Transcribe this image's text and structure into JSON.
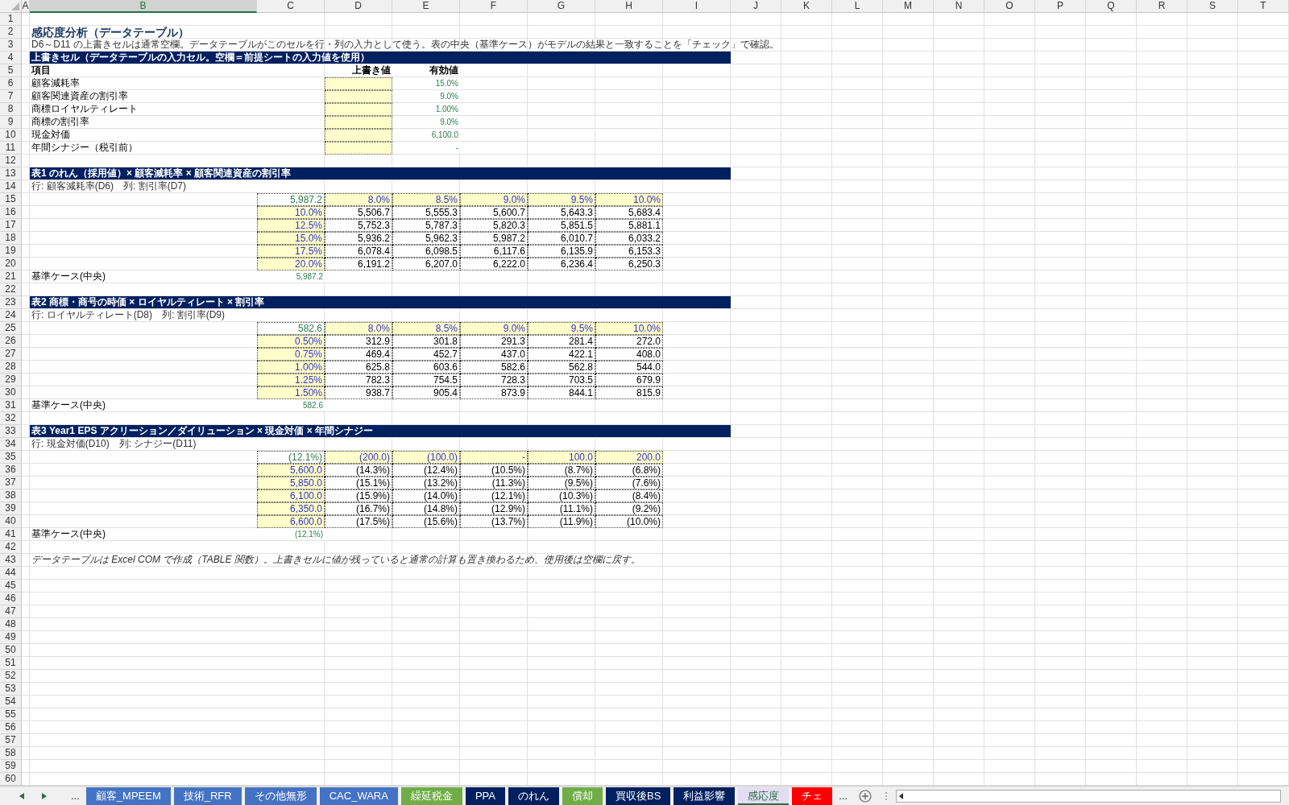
{
  "column_headers": [
    {
      "label": "A",
      "selected": false
    },
    {
      "label": "B",
      "selected": true
    },
    {
      "label": "C",
      "selected": false
    },
    {
      "label": "D",
      "selected": false
    },
    {
      "label": "E",
      "selected": false
    },
    {
      "label": "F",
      "selected": false
    },
    {
      "label": "G",
      "selected": false
    },
    {
      "label": "H",
      "selected": false
    },
    {
      "label": "I",
      "selected": false
    },
    {
      "label": "J",
      "selected": false
    },
    {
      "label": "K",
      "selected": false
    },
    {
      "label": "L",
      "selected": false
    },
    {
      "label": "M",
      "selected": false
    },
    {
      "label": "N",
      "selected": false
    },
    {
      "label": "O",
      "selected": false
    },
    {
      "label": "P",
      "selected": false
    },
    {
      "label": "Q",
      "selected": false
    },
    {
      "label": "R",
      "selected": false
    },
    {
      "label": "S",
      "selected": false
    },
    {
      "label": "T",
      "selected": false
    }
  ],
  "row_numbers": [
    "1",
    "2",
    "3",
    "4",
    "5",
    "6",
    "7",
    "8",
    "9",
    "10",
    "11",
    "12",
    "13",
    "14",
    "15",
    "16",
    "17",
    "18",
    "19",
    "20",
    "21",
    "22",
    "23",
    "24",
    "25",
    "26",
    "27",
    "28",
    "29",
    "30",
    "31",
    "32",
    "33",
    "34",
    "35",
    "36",
    "37",
    "38",
    "39",
    "40",
    "41",
    "42",
    "43",
    "44",
    "45",
    "46",
    "47",
    "48",
    "49",
    "50",
    "51",
    "52",
    "53",
    "54",
    "55",
    "56",
    "57",
    "58",
    "59",
    "60"
  ],
  "title": "感応度分析（データテーブル）",
  "note": "D6～D11 の上書きセルは通常空欄。データテーブルがこのセルを行・列の入力として使う。表の中央（基準ケース）がモデルの結果と一致することを「チェック」で確認。",
  "overrides": {
    "header": "上書きセル（データテーブルの入力セル。空欄＝前提シートの入力値を使用）",
    "columns": [
      "項目",
      "上書き値",
      "有効値"
    ],
    "items": [
      {
        "label": "顧客減耗率",
        "effective": "15.0%"
      },
      {
        "label": "顧客関連資産の割引率",
        "effective": "9.0%"
      },
      {
        "label": "商標ロイヤルティレート",
        "effective": "1.00%"
      },
      {
        "label": "商標の割引率",
        "effective": "9.0%"
      },
      {
        "label": "現金対価",
        "effective": "6,100.0"
      },
      {
        "label": "年間シナジー（税引前）",
        "effective": "-"
      }
    ]
  },
  "tables": [
    {
      "title": "表1 のれん（採用値）× 顧客減耗率 × 顧客関連資産の割引率",
      "axes": "行: 顧客減耗率(D6)　列: 割引率(D7)",
      "corner": "5,987.2",
      "columns": [
        "8.0%",
        "8.5%",
        "9.0%",
        "9.5%",
        "10.0%"
      ],
      "rows": [
        {
          "header": "10.0%",
          "values": [
            "5,506.7",
            "5,555.3",
            "5,600.7",
            "5,643.3",
            "5,683.4"
          ]
        },
        {
          "header": "12.5%",
          "values": [
            "5,752.3",
            "5,787.3",
            "5,820.3",
            "5,851.5",
            "5,881.1"
          ]
        },
        {
          "header": "15.0%",
          "values": [
            "5,936.2",
            "5,962.3",
            "5,987.2",
            "6,010.7",
            "6,033.2"
          ]
        },
        {
          "header": "17.5%",
          "values": [
            "6,078.4",
            "6,098.5",
            "6,117.6",
            "6,135.9",
            "6,153.3"
          ]
        },
        {
          "header": "20.0%",
          "values": [
            "6,191.2",
            "6,207.0",
            "6,222.0",
            "6,236.4",
            "6,250.3"
          ]
        }
      ],
      "base_label": "基準ケース(中央)",
      "base_value": "5,987.2"
    },
    {
      "title": "表2 商標・商号の時価 × ロイヤルティレート × 割引率",
      "axes": "行: ロイヤルティレート(D8)　列: 割引率(D9)",
      "corner": "582.6",
      "columns": [
        "8.0%",
        "8.5%",
        "9.0%",
        "9.5%",
        "10.0%"
      ],
      "rows": [
        {
          "header": "0.50%",
          "values": [
            "312.9",
            "301.8",
            "291.3",
            "281.4",
            "272.0"
          ]
        },
        {
          "header": "0.75%",
          "values": [
            "469.4",
            "452.7",
            "437.0",
            "422.1",
            "408.0"
          ]
        },
        {
          "header": "1.00%",
          "values": [
            "625.8",
            "603.6",
            "582.6",
            "562.8",
            "544.0"
          ]
        },
        {
          "header": "1.25%",
          "values": [
            "782.3",
            "754.5",
            "728.3",
            "703.5",
            "679.9"
          ]
        },
        {
          "header": "1.50%",
          "values": [
            "938.7",
            "905.4",
            "873.9",
            "844.1",
            "815.9"
          ]
        }
      ],
      "base_label": "基準ケース(中央)",
      "base_value": "582.6"
    },
    {
      "title": "表3 Year1 EPS アクリーション／ダイリューション × 現金対価 × 年間シナジー",
      "axes": "行: 現金対価(D10)　列: シナジー(D11)",
      "corner": "(12.1%)",
      "columns": [
        "(200.0)",
        "(100.0)",
        "-",
        "100.0",
        "200.0"
      ],
      "rows": [
        {
          "header": "5,600.0",
          "values": [
            "(14.3%)",
            "(12.4%)",
            "(10.5%)",
            "(8.7%)",
            "(6.8%)"
          ]
        },
        {
          "header": "5,850.0",
          "values": [
            "(15.1%)",
            "(13.2%)",
            "(11.3%)",
            "(9.5%)",
            "(7.6%)"
          ]
        },
        {
          "header": "6,100.0",
          "values": [
            "(15.9%)",
            "(14.0%)",
            "(12.1%)",
            "(10.3%)",
            "(8.4%)"
          ]
        },
        {
          "header": "6,350.0",
          "values": [
            "(16.7%)",
            "(14.8%)",
            "(12.9%)",
            "(11.1%)",
            "(9.2%)"
          ]
        },
        {
          "header": "6,600.0",
          "values": [
            "(17.5%)",
            "(15.6%)",
            "(13.7%)",
            "(11.9%)",
            "(10.0%)"
          ]
        }
      ],
      "base_label": "基準ケース(中央)",
      "base_value": "(12.1%)"
    }
  ],
  "footnote": "データテーブルは Excel COM で作成（TABLE 関数）。上書きセルに値が残っていると通常の計算も置き換わるため、使用後は空欄に戻す。",
  "sheet_tabs": {
    "more_left": "...",
    "more_right": "...",
    "tabs": [
      {
        "label": "顧客_MPEEM",
        "color": "#4472c4",
        "selected": false
      },
      {
        "label": "技術_RFR",
        "color": "#4472c4",
        "selected": false
      },
      {
        "label": "その他無形",
        "color": "#4472c4",
        "selected": false
      },
      {
        "label": "CAC_WARA",
        "color": "#4472c4",
        "selected": false
      },
      {
        "label": "繰延税金",
        "color": "#70ad47",
        "selected": false
      },
      {
        "label": "PPA",
        "color": "#002060",
        "selected": false
      },
      {
        "label": "のれん",
        "color": "#002060",
        "selected": false
      },
      {
        "label": "償却",
        "color": "#70ad47",
        "selected": false
      },
      {
        "label": "買収後BS",
        "color": "#002060",
        "selected": false
      },
      {
        "label": "利益影響",
        "color": "#002060",
        "selected": false
      },
      {
        "label": "感応度",
        "color": "#e4dcf0",
        "selected": true
      },
      {
        "label": "チェ",
        "color": "#ff0000",
        "selected": false
      }
    ]
  }
}
